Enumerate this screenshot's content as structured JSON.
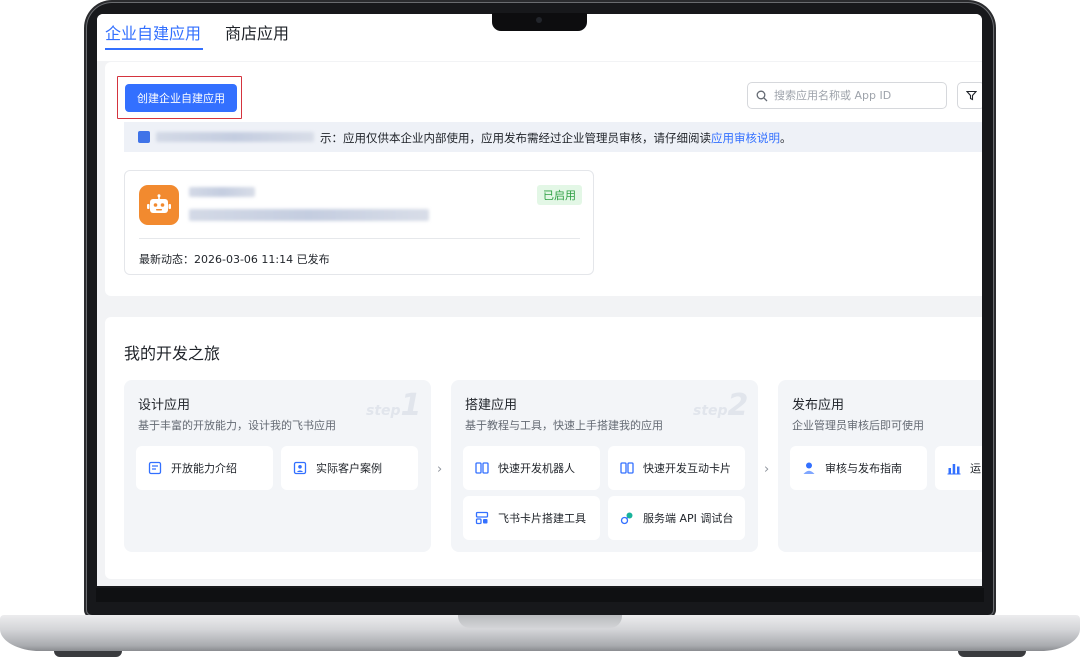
{
  "tabs": [
    {
      "label": "企业自建应用",
      "active": true
    },
    {
      "label": "商店应用",
      "active": false
    }
  ],
  "toolbar": {
    "create_label": "创建企业自建应用",
    "search_placeholder": "搜索应用名称或 App ID"
  },
  "notice": {
    "text": "示：应用仅供本企业内部使用，应用发布需经过企业管理员审核，请仔细阅读",
    "link": "应用审核说明",
    "suffix": "。"
  },
  "app": {
    "status": "已启用",
    "activity": "最新动态：2026-03-06 11:14 已发布"
  },
  "journey": {
    "title": "我的开发之旅",
    "steps": [
      {
        "title": "设计应用",
        "desc": "基于丰富的开放能力，设计我的飞书应用",
        "mark_word": "step",
        "mark_num": "1",
        "actions": [
          {
            "label": "开放能力介绍",
            "icon": "document-icon"
          },
          {
            "label": "实际客户案例",
            "icon": "user-card-icon"
          }
        ]
      },
      {
        "title": "搭建应用",
        "desc": "基于教程与工具，快速上手搭建我的应用",
        "mark_word": "step",
        "mark_num": "2",
        "actions": [
          {
            "label": "快速开发机器人",
            "icon": "book-icon"
          },
          {
            "label": "快速开发互动卡片",
            "icon": "book-icon"
          },
          {
            "label": "飞书卡片搭建工具",
            "icon": "layout-icon"
          },
          {
            "label": "服务端 API 调试台",
            "icon": "link-icon"
          }
        ]
      },
      {
        "title": "发布应用",
        "desc": "企业管理员审核后即可使用",
        "actions": [
          {
            "label": "审核与发布指南",
            "icon": "user-icon"
          },
          {
            "label": "运",
            "icon": "bar-chart-icon"
          }
        ]
      }
    ]
  },
  "colors": {
    "primary": "#3370ff",
    "highlight_outline": "#d4343e",
    "status_green": "#2ea043",
    "avatar_orange": "#f28a2f"
  }
}
